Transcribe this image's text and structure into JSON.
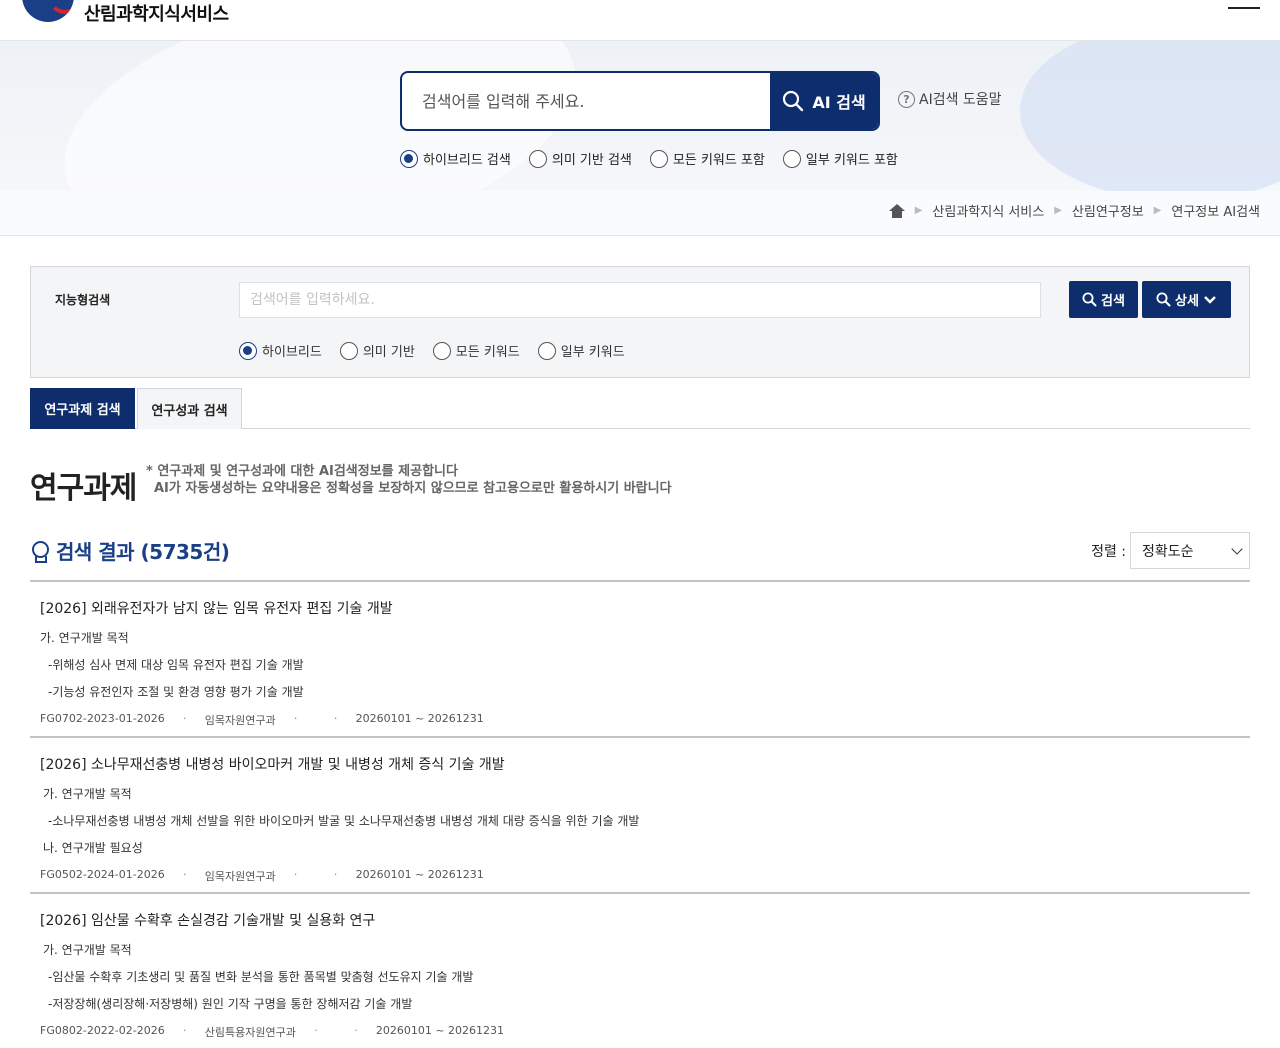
{
  "header": {
    "site_title": "산림과학지식서비스"
  },
  "hero": {
    "search_placeholder": "검색어를 입력해 주세요.",
    "search_button": "AI 검색",
    "help_label": "AI검색 도움말",
    "help_icon": "?",
    "modes": [
      {
        "label": "하이브리드 검색",
        "selected": true
      },
      {
        "label": "의미 기반 검색",
        "selected": false
      },
      {
        "label": "모든 키워드 포함",
        "selected": false
      },
      {
        "label": "일부 키워드 포함",
        "selected": false
      }
    ]
  },
  "breadcrumb": [
    "산림과학지식 서비스",
    "산림연구정보",
    "연구정보 AI검색"
  ],
  "filter": {
    "label": "지능형검색",
    "placeholder": "검색어를 입력하세요.",
    "search_button": "검색",
    "detail_button": "상세",
    "modes": [
      {
        "label": "하이브리드",
        "selected": true
      },
      {
        "label": "의미 기반",
        "selected": false
      },
      {
        "label": "모든 키워드",
        "selected": false
      },
      {
        "label": "일부 키워드",
        "selected": false
      }
    ]
  },
  "tabs": [
    {
      "label": "연구과제 검색",
      "active": true
    },
    {
      "label": "연구성과 검색",
      "active": false
    }
  ],
  "section": {
    "title": "연구과제",
    "note_line1": "* 연구과제 및 연구성과에 대한 AI검색정보를 제공합니다",
    "note_line2": "AI가 자동생성하는 요약내용은 정확성을 보장하지 않으므로 참고용으로만 활용하시기 바랍니다"
  },
  "results_header": {
    "title": "검색 결과 (5735건)",
    "sort_label": "정렬 :",
    "sort_value": "정확도순"
  },
  "results": [
    {
      "title": "[2026] 외래유전자가 남지 않는 임목 유전자 편집 기술 개발",
      "lines": [
        "가. 연구개발 목적",
        "-위해성 심사 면제 대상 임목 유전자 편집 기술 개발",
        "-기능성 유전인자 조절 및 환경 영향 평가 기술 개발"
      ],
      "code": "FG0702-2023-01-2026",
      "dept": "임목자원연구과",
      "period": "20260101 ~ 20261231"
    },
    {
      "title": "[2026] 소나무재선충병 내병성 바이오마커 개발 및 내병성 개체 증식 기술 개발",
      "lines": [
        "가. 연구개발 목적",
        "-소나무재선충병 내병성 개체 선발을 위한 바이오마커 발굴 및 소나무재선충병 내병성 개체 대량 증식을 위한 기술 개발",
        "나. 연구개발 필요성"
      ],
      "code": "FG0502-2024-01-2026",
      "dept": "임목자원연구과",
      "period": "20260101 ~ 20261231"
    },
    {
      "title": "[2026] 임산물 수확후 손실경감 기술개발 및 실용화 연구",
      "lines": [
        "가. 연구개발 목적",
        "-임산물 수확후 기초생리 및 품질 변화 분석을 통한 품목별 맞춤형 선도유지 기술 개발",
        "-저장장해(생리장해·저장병해) 원인 기작 구명을 통한 장해저감 기술 개발"
      ],
      "code": "FG0802-2022-02-2026",
      "dept": "산림특용자원연구과",
      "period": "20260101 ~ 20261231"
    }
  ],
  "colors": {
    "navy": "#0d2d6c",
    "accent_blue": "#1b3f86"
  },
  "icons": [
    "logo-emblem-icon",
    "menu-icon",
    "search-icon",
    "help-icon",
    "home-icon",
    "bulb-icon",
    "chevron-down-icon"
  ]
}
